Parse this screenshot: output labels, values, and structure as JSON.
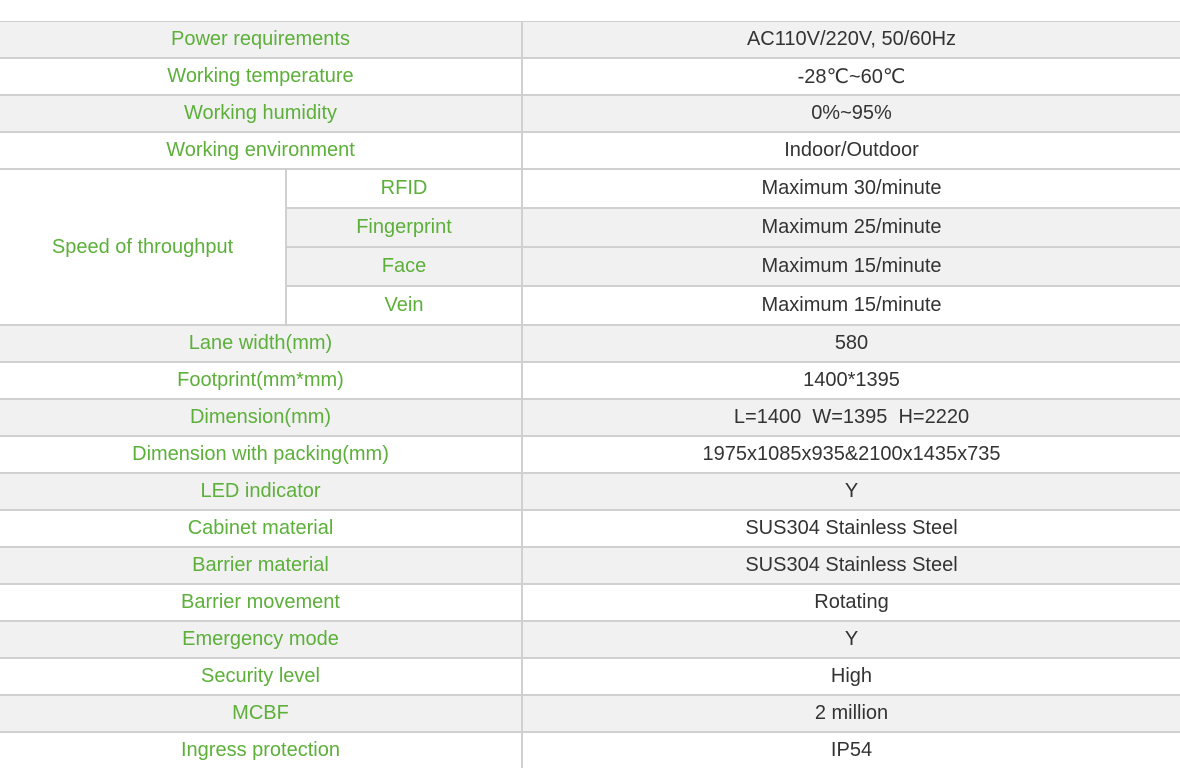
{
  "colors": {
    "label": "#5cb03a",
    "value": "#333333",
    "shade": "#f1f1f1",
    "border": "#d0d0d0"
  },
  "specs": {
    "power": {
      "label": "Power requirements",
      "value": "AC110V/220V, 50/60Hz"
    },
    "temp": {
      "label": "Working temperature",
      "value": "-28℃~60℃"
    },
    "humidity": {
      "label": "Working humidity",
      "value": "0%~95%"
    },
    "environment": {
      "label": "Working environment",
      "value": "Indoor/Outdoor"
    },
    "throughput": {
      "label": "Speed of throughput",
      "rows": [
        {
          "label": "RFID",
          "value": "Maximum 30/minute"
        },
        {
          "label": "Fingerprint",
          "value": "Maximum 25/minute"
        },
        {
          "label": "Face",
          "value": "Maximum 15/minute"
        },
        {
          "label": "Vein",
          "value": "Maximum 15/minute"
        }
      ]
    },
    "lane_width": {
      "label": "Lane width(mm)",
      "value": "580"
    },
    "footprint": {
      "label": "Footprint(mm*mm)",
      "value": "1400*1395"
    },
    "dimension": {
      "label": "Dimension(mm)",
      "value": "L=1400  W=1395  H=2220"
    },
    "dimension_packing": {
      "label": "Dimension with packing(mm)",
      "value": "1975x1085x935&2100x1435x735"
    },
    "led": {
      "label": "LED indicator",
      "value": "Y"
    },
    "cabinet": {
      "label": "Cabinet material",
      "value": "SUS304 Stainless Steel"
    },
    "barrier_material": {
      "label": "Barrier material",
      "value": "SUS304 Stainless Steel"
    },
    "barrier_movement": {
      "label": "Barrier movement",
      "value": "Rotating"
    },
    "emergency": {
      "label": "Emergency mode",
      "value": "Y"
    },
    "security": {
      "label": "Security level",
      "value": "High"
    },
    "mcbf": {
      "label": "MCBF",
      "value": "2 million"
    },
    "ingress": {
      "label": "Ingress protection",
      "value": "IP54"
    }
  }
}
